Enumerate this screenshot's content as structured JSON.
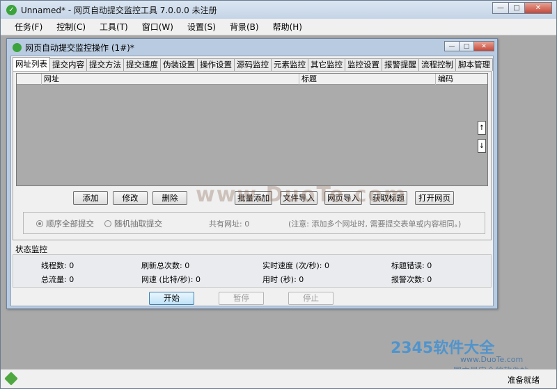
{
  "app": {
    "title": "Unnamed* - 网页自动提交监控工具 7.0.0.0  未注册",
    "controls": {
      "minimize": "—",
      "maximize": "□",
      "close": "✕"
    }
  },
  "menu": [
    "任务(F)",
    "控制(C)",
    "工具(T)",
    "窗口(W)",
    "设置(S)",
    "背景(B)",
    "帮助(H)"
  ],
  "child": {
    "title": "网页自动提交监控操作  (1#)*",
    "controls": {
      "minimize": "—",
      "maximize": "□",
      "close": "✕"
    }
  },
  "tabs": [
    "网址列表",
    "提交内容",
    "提交方法",
    "提交速度",
    "伪装设置",
    "操作设置",
    "源码监控",
    "元素监控",
    "其它监控",
    "监控设置",
    "报警提醒",
    "流程控制",
    "脚本管理"
  ],
  "grid": {
    "columns": [
      "网址",
      "标题",
      "编码"
    ],
    "scroll_up": "↑",
    "scroll_down": "↓"
  },
  "buttons": [
    "添加",
    "修改",
    "删除",
    "批量添加",
    "文件导入",
    "网页导入",
    "获取标题",
    "打开网页"
  ],
  "options": {
    "radio1": "顺序全部提交",
    "radio2": "随机抽取提交",
    "total": "共有网址: 0",
    "note": "(注意: 添加多个网址时, 需要提交表单或内容相同。)"
  },
  "status": {
    "title": "状态监控",
    "threads": "线程数:  0",
    "refresh_total": "刷新总次数:  0",
    "speed": "实时速度 (次/秒):  0",
    "title_errors": "标题错误:  0",
    "total_traffic": "总流量:  0",
    "net_speed": "网速 (比特/秒):  0",
    "time_used": "用时 (秒):  0",
    "alarm_count": "报警次数:  0"
  },
  "controls": {
    "start": "开始",
    "pause": "暂停",
    "stop": "停止"
  },
  "statusbar": {
    "text": "准备就绪"
  },
  "watermark": {
    "center": "www.DuoTe.com",
    "corner_brand": "2345软件大全",
    "corner_url": "www.DuoTe.com",
    "corner_slogan": "国内最安全的软件站"
  },
  "colors": {
    "accent": "#3c7fb1",
    "icon_green": "#3ba33b",
    "mdi_bg": "#a9a9a9"
  }
}
